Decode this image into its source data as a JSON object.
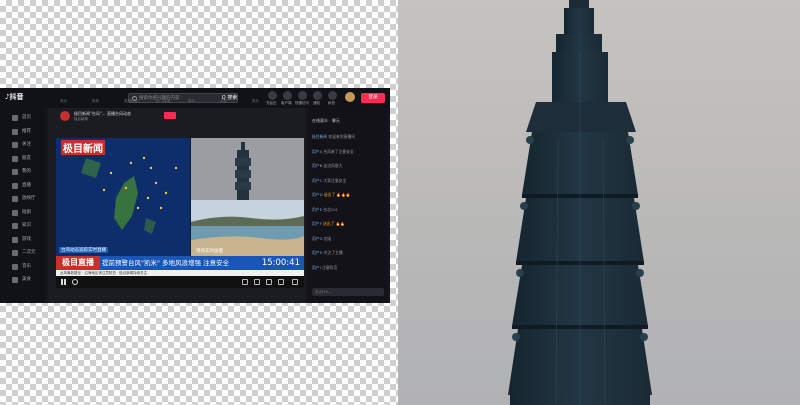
{
  "app": {
    "logo": "♪抖音",
    "search_placeholder": "搜索你感兴趣的内容",
    "search_button": "Q 搜索",
    "topbar_items": [
      "充钻石",
      "客户端",
      "快捷访问",
      "通知",
      "私信",
      "投稿"
    ],
    "login_button": "登录"
  },
  "sidebar": {
    "items": [
      "首页",
      "推荐",
      "关注",
      "朋友",
      "我的",
      "直播",
      "放映厅",
      "短剧",
      "知识",
      "游戏",
      "二次元",
      "音乐",
      "美食"
    ]
  },
  "stream": {
    "streamer_title": "极目新闻\"台风\"… 直播台风动态",
    "streamer_sub": "极目新闻",
    "nav_tabs": [
      "首页",
      "推荐",
      "直播精选",
      "热门直播",
      "娱乐",
      "游戏",
      "更多"
    ],
    "logo_text": "极目新闻",
    "news_label": "台风动态追踪实时直播",
    "sea_caption": "现场实时画面",
    "ticker_brand": "极目直播",
    "ticker_text": "提前预警台风\"凯米\" 多地风浪增强 注意安全",
    "ticker_clock": "15:00:41",
    "subticker_text": "台风最新路径 · 沿海地区请注意防范 · 极目新闻持续关注"
  },
  "chat": {
    "header": "在线观众 · 聊天",
    "lines": [
      {
        "name": "极目新闻",
        "text": "欢迎来到直播间"
      },
      {
        "name": "用户A",
        "text": "台风来了注意安全"
      },
      {
        "name": "用户B",
        "text": "这边风很大"
      },
      {
        "name": "用户C",
        "text": "大家注意安全"
      },
      {
        "name": "用户D",
        "text": "送出了 🔥🔥🔥",
        "gift": true
      },
      {
        "name": "用户E",
        "text": "台北101"
      },
      {
        "name": "用户F",
        "text": "送出了 🔥🔥",
        "gift": true
      },
      {
        "name": "用户G",
        "text": "加油"
      },
      {
        "name": "用户H",
        "text": "关注了主播"
      },
      {
        "name": "用户I",
        "text": "注意防范"
      }
    ],
    "input_placeholder": "说点什么…"
  },
  "colors": {
    "brand": "#fe2c55",
    "news_red": "#c9302c",
    "news_blue": "#1a56b5",
    "sky": "#bdbcba",
    "tower": "#1f3341"
  }
}
